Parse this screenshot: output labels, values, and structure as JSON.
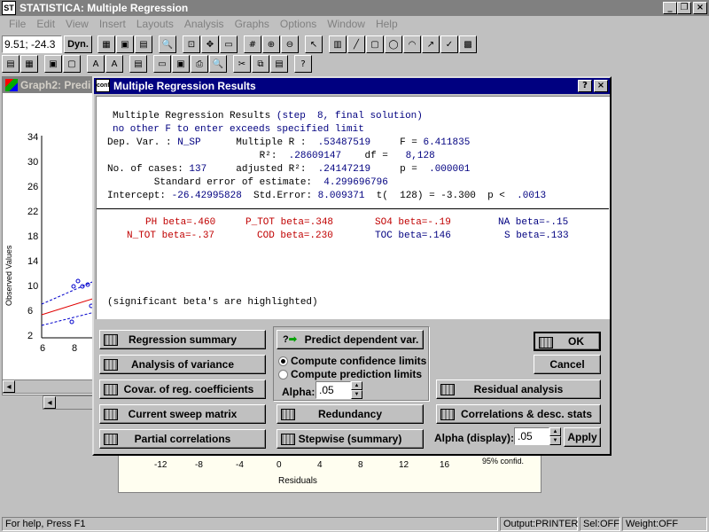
{
  "app": {
    "title": "STATISTICA: Multiple Regression",
    "icon_text": "ST"
  },
  "menu": [
    "File",
    "Edit",
    "View",
    "Insert",
    "Layouts",
    "Analysis",
    "Graphs",
    "Options",
    "Window",
    "Help"
  ],
  "toolbar": {
    "coordinate": "9.51; -24.3",
    "dyn_label": "Dyn."
  },
  "graph2": {
    "title": "Graph2: Predi",
    "ylabel": "Observed Values",
    "yticks": [
      "34",
      "32",
      "30",
      "28",
      "26",
      "24",
      "22",
      "20",
      "18",
      "16",
      "14",
      "12",
      "10",
      "8",
      "6",
      "4",
      "2"
    ],
    "xticks": [
      "6",
      "8"
    ]
  },
  "graph_bottom": {
    "xticks": [
      "-12",
      "-8",
      "-4",
      "0",
      "4",
      "8",
      "12",
      "16"
    ],
    "xlabel": "Residuals",
    "conf": "95% confid."
  },
  "dialog": {
    "title": "Multiple Regression Results",
    "icon_text": "conf",
    "help_btn": "?",
    "close_btn": "×",
    "results": {
      "l1a": "Multiple Regression Results ",
      "l1b": "(step  8, final solution)",
      "l2": "no other F to enter exceeds specified limit",
      "l3a": "Dep. Var. : ",
      "l3b": "N_SP",
      "l3c": "      Multiple R : ",
      "l3d": " .53487519",
      "l3e": "     F = ",
      "l3f": "6.411835",
      "l4a": "                          R²: ",
      "l4b": " .28609147",
      "l4c": "    df = ",
      "l4d": "  8,128",
      "l5a": "No. of cases: ",
      "l5b": "137",
      "l5c": "     adjusted R²: ",
      "l5d": " .24147219",
      "l5e": "     p = ",
      "l5f": " .000001",
      "l6a": "        Standard error of estimate: ",
      "l6b": " 4.299696796",
      "l7a": "Intercept: ",
      "l7b": "-26.42995828",
      "l7c": "  Std.Error: ",
      "l7d": "8.009371",
      "l7e": "  t(  128) = -3.300  p < ",
      "l7f": " .0013",
      "betas_row1": [
        {
          "text": "PH beta=.460",
          "color": "red"
        },
        {
          "text": "P_TOT beta=.348",
          "color": "red"
        },
        {
          "text": "SO4 beta=-.19",
          "color": "red"
        },
        {
          "text": "NA beta=-.15",
          "color": "blue"
        }
      ],
      "betas_row2": [
        {
          "text": "N_TOT beta=-.37",
          "color": "red"
        },
        {
          "text": "COD beta=.230",
          "color": "red"
        },
        {
          "text": "TOC beta=.146",
          "color": "blue"
        },
        {
          "text": "S beta=.133",
          "color": "blue"
        }
      ],
      "footnote": "(significant beta's are highlighted)"
    },
    "buttons": {
      "regression_summary": "Regression summary",
      "analysis_of_variance": "Analysis of variance",
      "covar": "Covar. of reg. coefficients",
      "current_sweep": "Current sweep matrix",
      "partial_corr": "Partial correlations",
      "predict": "Predict dependent var.",
      "redundancy": "Redundancy",
      "stepwise": "Stepwise (summary)",
      "ok": "OK",
      "cancel": "Cancel",
      "residual_analysis": "Residual analysis",
      "correlations": "Correlations & desc. stats",
      "apply": "Apply"
    },
    "radios": {
      "confidence": "Compute confidence limits",
      "prediction": "Compute prediction limits"
    },
    "alpha": {
      "label": "Alpha:",
      "value": ".05"
    },
    "alpha_display": {
      "label": "Alpha (display):",
      "value": ".05"
    }
  },
  "status": {
    "help": "For help, Press F1",
    "output": "Output:PRINTER",
    "sel": "Sel:OFF",
    "weight": "Weight:OFF"
  },
  "colors": {
    "title_active": "#000080",
    "red": "#c00000",
    "blue": "#000080"
  }
}
